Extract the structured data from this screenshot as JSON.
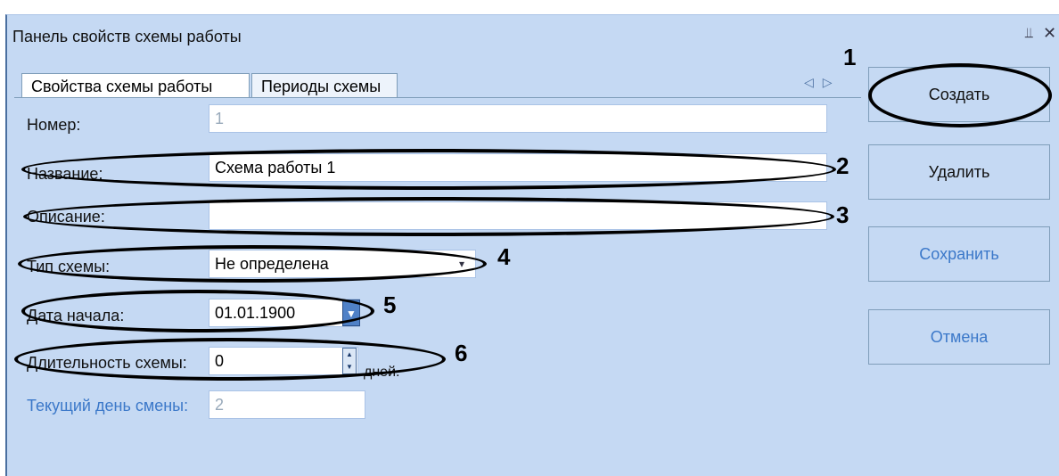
{
  "panel": {
    "title": "Панель свойств схемы работы",
    "pin_icon": "pin-icon",
    "close_icon": "close-icon"
  },
  "tabs": [
    {
      "label": "Свойства схемы работы",
      "active": true
    },
    {
      "label": "Периоды схемы",
      "active": false
    }
  ],
  "form": {
    "number": {
      "label": "Номер:",
      "value": "1"
    },
    "name": {
      "label": "Название:",
      "value": "Схема работы 1"
    },
    "description": {
      "label": "Описание:",
      "value": ""
    },
    "scheme_type": {
      "label": "Тип схемы:",
      "value": "Не определена"
    },
    "start_date": {
      "label": "Дата начала:",
      "value": "01.01.1900"
    },
    "duration": {
      "label": "Длительность схемы:",
      "value": "0",
      "unit": "дней."
    },
    "current_day": {
      "label": "Текущий день смены:",
      "value": "2"
    }
  },
  "buttons": {
    "create": "Создать",
    "delete": "Удалить",
    "save": "Сохранить",
    "cancel": "Отмена"
  },
  "callouts": [
    "1",
    "2",
    "3",
    "4",
    "5",
    "6"
  ],
  "colors": {
    "panel_bg": "#c5d9f3",
    "accent": "#4f81c7",
    "disabled_text": "#3b78c9"
  }
}
